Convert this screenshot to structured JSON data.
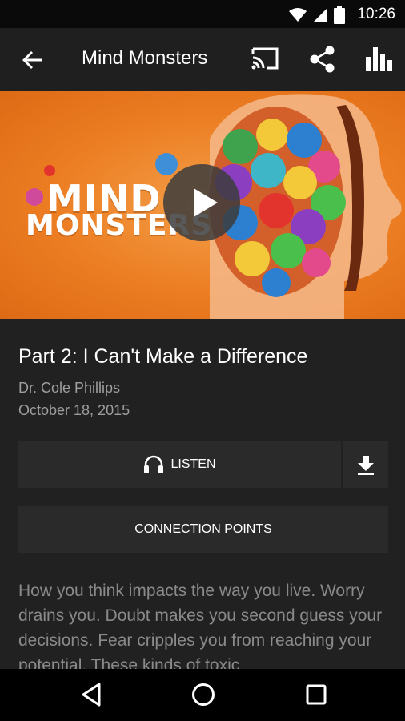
{
  "status_bar": {
    "time": "10:26",
    "icons": [
      "wifi-icon",
      "signal-icon",
      "battery-icon"
    ]
  },
  "app_bar": {
    "title": "Mind Monsters",
    "icons": [
      "back-arrow-icon",
      "cast-icon",
      "share-icon",
      "bar-chart-icon"
    ]
  },
  "hero": {
    "artwork_text_line1": "MIND",
    "artwork_text_line2": "MONSTERS",
    "colors": {
      "background": "#ec7d22"
    }
  },
  "episode": {
    "title": "Part 2: I Can't Make a Difference",
    "speaker": "Dr. Cole Phillips",
    "date": "October 18, 2015"
  },
  "actions": {
    "listen_label": "LISTEN",
    "connection_points_label": "CONNECTION POINTS"
  },
  "description": "How you think impacts the way you live. Worry drains you. Doubt makes you second guess your decisions. Fear cripples you from reaching your potential. These kinds of toxic",
  "nav_bar": {
    "icons": [
      "back-triangle-icon",
      "home-circle-icon",
      "recents-square-icon"
    ]
  },
  "colors": {
    "background": "#212121",
    "app_bar": "#1f1f1f",
    "button": "#2a2a2a",
    "text_secondary": "#9e9e9e"
  }
}
